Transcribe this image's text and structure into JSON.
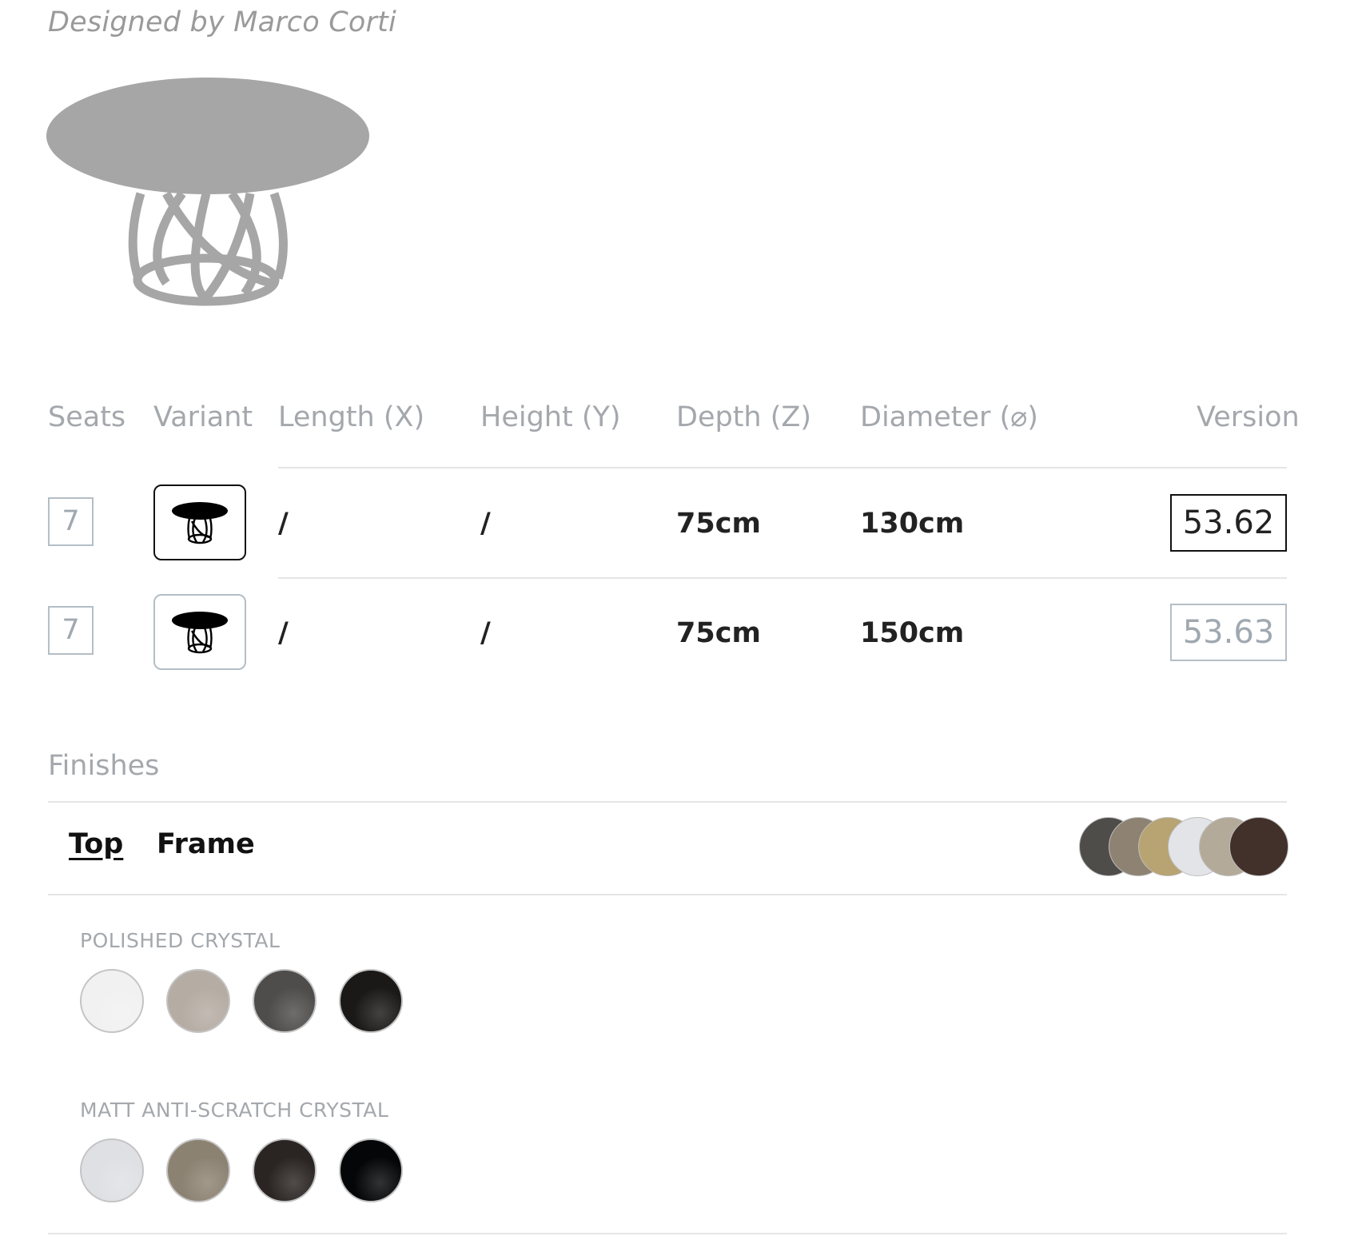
{
  "designer": "Designed by Marco Corti",
  "product_image": "round-table-silhouette",
  "table": {
    "headers": {
      "seats": "Seats",
      "variant": "Variant",
      "length": "Length (X)",
      "height": "Height (Y)",
      "depth": "Depth (Z)",
      "diameter": "Diameter (⌀)",
      "version": "Version"
    },
    "rows": [
      {
        "seats": "7",
        "variant_icon": "round-table-icon",
        "length": "/",
        "height": "/",
        "depth": "75cm",
        "diameter": "130cm",
        "version": "53.62",
        "selected": true
      },
      {
        "seats": "7",
        "variant_icon": "round-table-icon",
        "length": "/",
        "height": "/",
        "depth": "75cm",
        "diameter": "150cm",
        "version": "53.63",
        "selected": false
      }
    ]
  },
  "finishes": {
    "title": "Finishes",
    "tabs": [
      {
        "label": "Top",
        "active": true
      },
      {
        "label": "Frame",
        "active": false
      }
    ],
    "preview_colors": [
      "#4f4d4a",
      "#8e8272",
      "#b8a372",
      "#e3e4e8",
      "#b4aa99",
      "#42302a"
    ],
    "groups": [
      {
        "label": "POLISHED CRYSTAL",
        "swatches": [
          {
            "name": "polished-white",
            "color": "#f1f1f2"
          },
          {
            "name": "polished-taupe",
            "color": "#b5aca3"
          },
          {
            "name": "polished-grey",
            "color": "#4f4d4b"
          },
          {
            "name": "polished-black",
            "color": "#1a1918"
          }
        ]
      },
      {
        "label": "MATT ANTI-SCRATCH CRYSTAL",
        "swatches": [
          {
            "name": "matt-white",
            "color": "#dfe0e4"
          },
          {
            "name": "matt-taupe",
            "color": "#8c8272"
          },
          {
            "name": "matt-brown",
            "color": "#2a2523"
          },
          {
            "name": "matt-black",
            "color": "#050607"
          }
        ]
      }
    ]
  },
  "colors": {
    "header_text": "#a4a8ad",
    "silhouette": "#a6a6a6",
    "selected_border": "#111111",
    "inactive_border": "#b4bec6"
  }
}
